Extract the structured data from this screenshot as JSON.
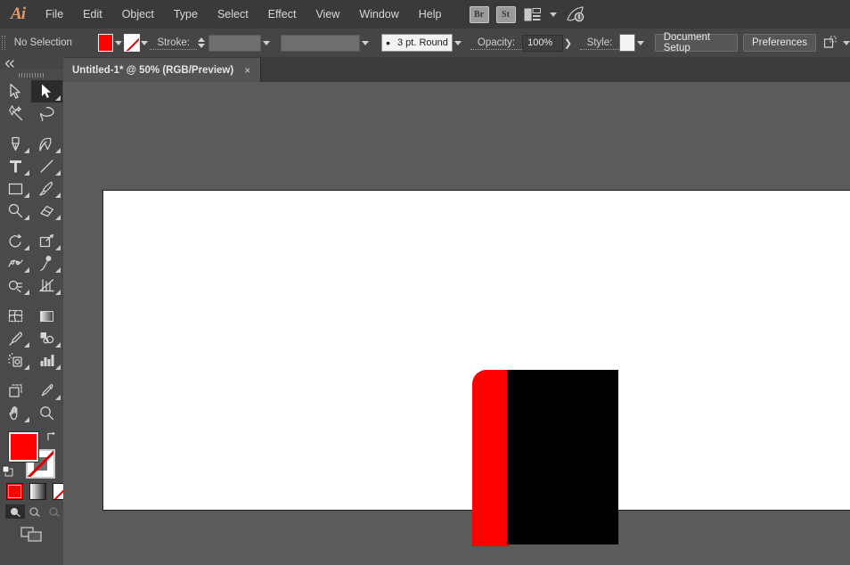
{
  "app": {
    "name": "Adobe Illustrator",
    "logo_text": "Ai"
  },
  "menubar": {
    "items": [
      {
        "label": "File"
      },
      {
        "label": "Edit"
      },
      {
        "label": "Object"
      },
      {
        "label": "Type"
      },
      {
        "label": "Select"
      },
      {
        "label": "Effect"
      },
      {
        "label": "View"
      },
      {
        "label": "Window"
      },
      {
        "label": "Help"
      }
    ],
    "bridge_label": "Br",
    "stock_label": "St",
    "arrange_icon": "arrange-documents-icon",
    "arrange_chevron_icon": "chevron-down-icon",
    "rocket_icon": "search-adobe-stock-icon"
  },
  "controlbar": {
    "selection_status": "No Selection",
    "fill_label": "fill-swatch",
    "fill_color": "#ff0000",
    "stroke_swatch_label": "stroke-swatch-none",
    "stroke_label": "Stroke:",
    "stroke_weight_value": "",
    "brush_preset": "3 pt. Round",
    "opacity_label": "Opacity:",
    "opacity_value": "100%",
    "style_label": "Style:",
    "style_swatch_color": "#f2f2f2",
    "document_setup_label": "Document Setup",
    "preferences_label": "Preferences",
    "align_icon": "align-to-artboard-icon"
  },
  "tabbar": {
    "tabs": [
      {
        "title": "Untitled-1* @ 50% (RGB/Preview)",
        "close_label": "×",
        "active": true
      }
    ]
  },
  "toolbar": {
    "collapse_icon": "double-chevron-left-icon",
    "tools": [
      {
        "name": "selection-tool",
        "title": "Selection",
        "selected": false
      },
      {
        "name": "direct-selection-tool",
        "title": "Direct Selection",
        "selected": true
      },
      {
        "name": "magic-wand-tool",
        "title": "Magic Wand",
        "selected": false
      },
      {
        "name": "lasso-tool",
        "title": "Lasso",
        "selected": false
      },
      {
        "name": "pen-tool",
        "title": "Pen",
        "selected": false
      },
      {
        "name": "curvature-tool",
        "title": "Curvature",
        "selected": false
      },
      {
        "name": "type-tool",
        "title": "Type",
        "selected": false
      },
      {
        "name": "line-segment-tool",
        "title": "Line Segment",
        "selected": false
      },
      {
        "name": "rectangle-tool",
        "title": "Rectangle",
        "selected": false
      },
      {
        "name": "paintbrush-tool",
        "title": "Paintbrush",
        "selected": false
      },
      {
        "name": "shaper-tool",
        "title": "Shaper",
        "selected": false
      },
      {
        "name": "eraser-tool",
        "title": "Eraser",
        "selected": false
      },
      {
        "name": "rotate-tool",
        "title": "Rotate",
        "selected": false
      },
      {
        "name": "scale-tool",
        "title": "Scale",
        "selected": false
      },
      {
        "name": "width-tool",
        "title": "Width",
        "selected": false
      },
      {
        "name": "free-transform-tool",
        "title": "Free Transform",
        "selected": false
      },
      {
        "name": "shape-builder-tool",
        "title": "Shape Builder",
        "selected": false
      },
      {
        "name": "perspective-grid-tool",
        "title": "Perspective Grid",
        "selected": false
      },
      {
        "name": "mesh-tool",
        "title": "Mesh",
        "selected": false
      },
      {
        "name": "gradient-tool",
        "title": "Gradient",
        "selected": false
      },
      {
        "name": "eyedropper-tool",
        "title": "Eyedropper",
        "selected": false
      },
      {
        "name": "blend-tool",
        "title": "Blend",
        "selected": false
      },
      {
        "name": "symbol-sprayer-tool",
        "title": "Symbol Sprayer",
        "selected": false
      },
      {
        "name": "column-graph-tool",
        "title": "Column Graph",
        "selected": false
      },
      {
        "name": "artboard-tool",
        "title": "Artboard",
        "selected": false
      },
      {
        "name": "slice-tool",
        "title": "Slice",
        "selected": false
      },
      {
        "name": "hand-tool",
        "title": "Hand",
        "selected": false
      },
      {
        "name": "zoom-tool",
        "title": "Zoom",
        "selected": false
      }
    ],
    "fill_color": "#ff0000",
    "stroke_color": "none",
    "swap_icon": "swap-fill-stroke-icon",
    "default_icon": "default-fill-stroke-icon",
    "color_mode_label": "color-button",
    "gradient_mode_label": "gradient-button",
    "none_mode_label": "none-button",
    "draw_modes": [
      {
        "name": "draw-normal",
        "active": true
      },
      {
        "name": "draw-behind",
        "active": false
      },
      {
        "name": "draw-inside",
        "active": false
      }
    ],
    "screen_mode_label": "change-screen-mode"
  },
  "canvas": {
    "zoom_level": "50%",
    "color_mode": "RGB",
    "view_mode": "Preview",
    "background_color": "#5b5b5b",
    "artboard_color": "#ffffff",
    "artwork": [
      {
        "name": "red-rounded-shape",
        "color": "#ff0000",
        "shape": "rounded-rect-top-left"
      },
      {
        "name": "black-rectangle",
        "color": "#000000",
        "shape": "rect"
      }
    ]
  }
}
